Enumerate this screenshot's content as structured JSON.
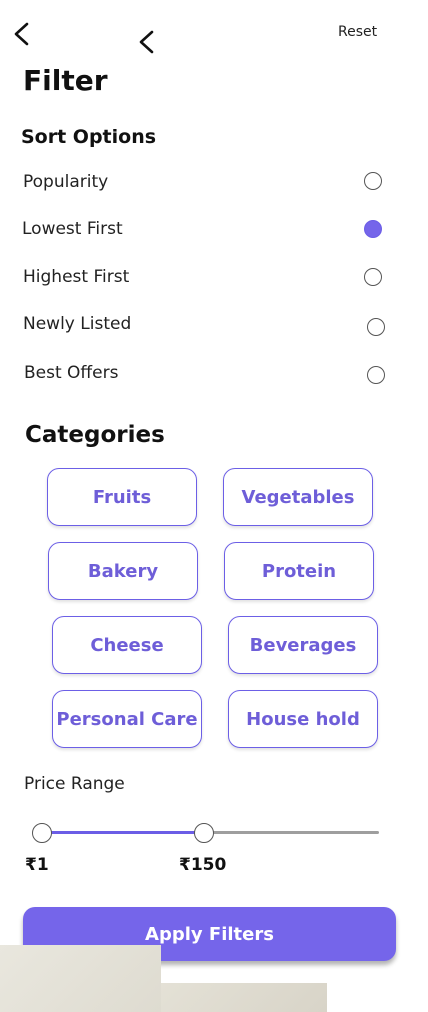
{
  "header": {
    "reset_label": "Reset",
    "title": "Filter"
  },
  "sort": {
    "title": "Sort Options",
    "options": [
      {
        "label": "Popularity",
        "selected": false
      },
      {
        "label": "Lowest First",
        "selected": true
      },
      {
        "label": "Highest First",
        "selected": false
      },
      {
        "label": "Newly Listed",
        "selected": false
      },
      {
        "label": "Best Offers",
        "selected": false
      }
    ]
  },
  "categories": {
    "title": "Categories",
    "items": [
      "Fruits",
      "Vegetables",
      "Bakery",
      "Protein",
      "Cheese",
      "Beverages",
      "Personal Care",
      "House hold"
    ]
  },
  "price": {
    "title": "Price Range",
    "min_label": "₹1",
    "max_label": "₹150",
    "range_min": 1,
    "range_selected_max": 150
  },
  "apply_label": "Apply Filters",
  "colors": {
    "accent": "#7565ea",
    "chip_text": "#6e5ed8"
  }
}
